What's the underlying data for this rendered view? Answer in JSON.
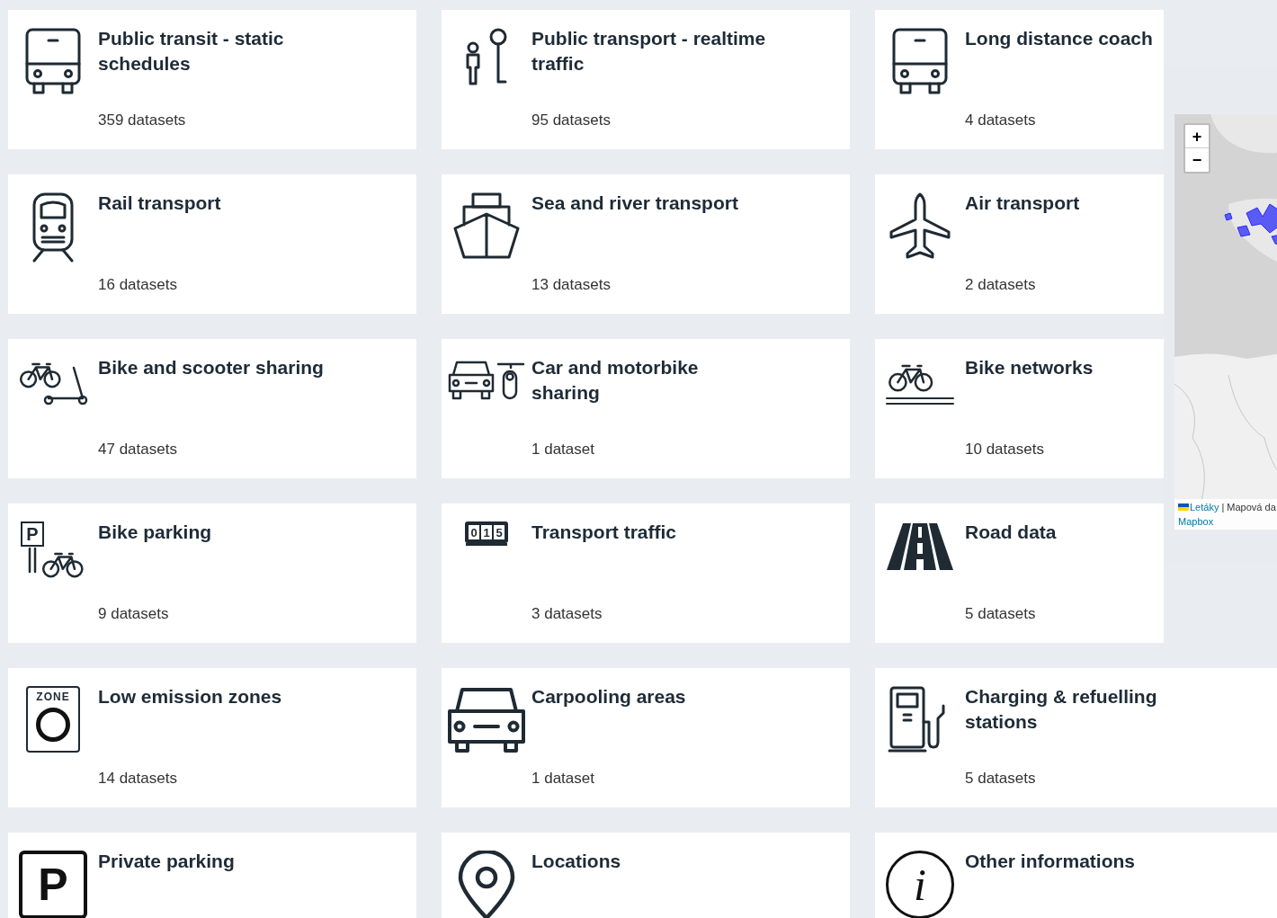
{
  "cards": [
    {
      "kind": "bus",
      "title": [
        "Public transit - static",
        "schedules"
      ],
      "count": "359 datasets"
    },
    {
      "kind": "stop",
      "title": [
        "Public transport - realtime",
        "traffic"
      ],
      "count": "95 datasets"
    },
    {
      "kind": "bus",
      "title": [
        "Long distance coach"
      ],
      "count": "4 datasets"
    },
    {
      "kind": "rail",
      "title": [
        "Rail transport"
      ],
      "count": "16 datasets"
    },
    {
      "kind": "ship",
      "title": [
        "Sea and river transport"
      ],
      "count": "13 datasets"
    },
    {
      "kind": "plane",
      "title": [
        "Air transport"
      ],
      "count": "2 datasets"
    },
    {
      "kind": "bike_scooter",
      "title": [
        "Bike and scooter sharing"
      ],
      "count": "47 datasets"
    },
    {
      "kind": "car_moto",
      "title": [
        "Car and motorbike",
        "sharing"
      ],
      "count": "1 dataset"
    },
    {
      "kind": "bike_network",
      "title": [
        "Bike networks"
      ],
      "count": "10 datasets"
    },
    {
      "kind": "bike_parking",
      "icon_text": "P",
      "title": [
        "Bike parking"
      ],
      "count": "9 datasets"
    },
    {
      "kind": "counter",
      "digits": [
        "0",
        "1",
        "5"
      ],
      "title": [
        "Transport traffic"
      ],
      "count": "3 datasets"
    },
    {
      "kind": "road",
      "title": [
        "Road data"
      ],
      "count": "5 datasets"
    },
    {
      "kind": "zone",
      "icon_text": "ZONE",
      "title": [
        "Low emission zones"
      ],
      "count": "14 datasets"
    },
    {
      "kind": "car",
      "title": [
        "Carpooling areas"
      ],
      "count": "1 dataset"
    },
    {
      "kind": "fuel",
      "title": [
        "Charging & refuelling",
        "stations"
      ],
      "count": "5 datasets"
    },
    {
      "kind": "parking",
      "icon_text": "P",
      "title": [
        "Private parking"
      ]
    },
    {
      "kind": "pin",
      "title": [
        "Locations"
      ]
    },
    {
      "kind": "info",
      "icon_text": "i",
      "title": [
        "Other informations"
      ]
    }
  ],
  "map": {
    "zoom_in": "+",
    "zoom_out": "−",
    "attribution_link": "Letáky",
    "attribution_text": "| Mapová da",
    "provider": "Mapbox"
  }
}
